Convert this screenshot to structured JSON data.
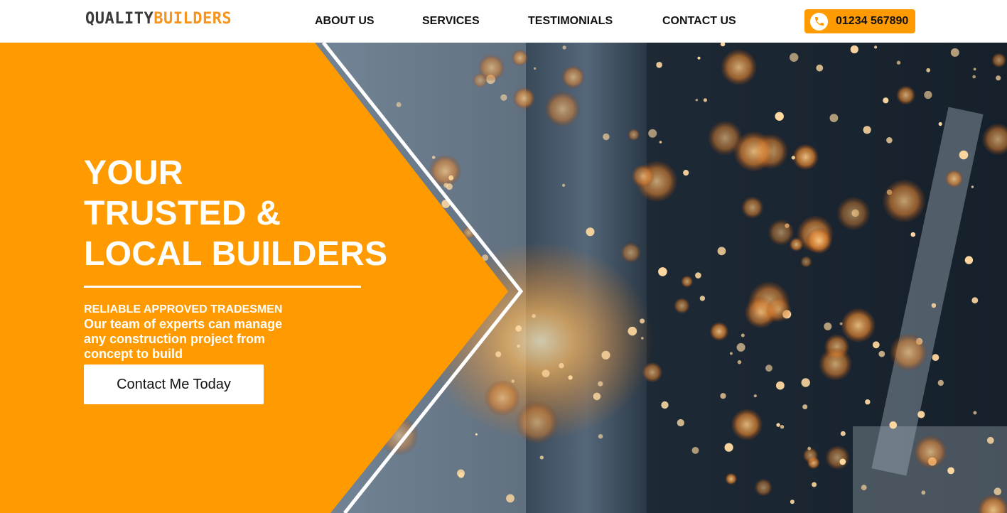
{
  "header": {
    "logo": {
      "part1": "QUALITY",
      "part2": "BUILDERS"
    },
    "nav": {
      "about": "ABOUT US",
      "services": "SERVICES",
      "testimonials": "TESTIMONIALS",
      "contact": "CONTACT US"
    },
    "phone": {
      "number": "01234 567890",
      "icon": "phone-icon"
    }
  },
  "hero": {
    "title_lines": [
      "YOUR",
      "TRUSTED &",
      "LOCAL BUILDERS"
    ],
    "eyebrow": "RELIABLE APPROVED TRADESMEN",
    "text": "Our team of experts can manage any construction project from concept to build",
    "cta_label": "Contact Me Today",
    "background_image": "welding-sparks-photo"
  },
  "colors": {
    "accent": "#ff9b00",
    "logo_dark": "#3a3a3a",
    "logo_orange": "#f7941d",
    "header_bg": "#ffffff",
    "text_dark": "#111111",
    "text_light": "#ffffff"
  }
}
